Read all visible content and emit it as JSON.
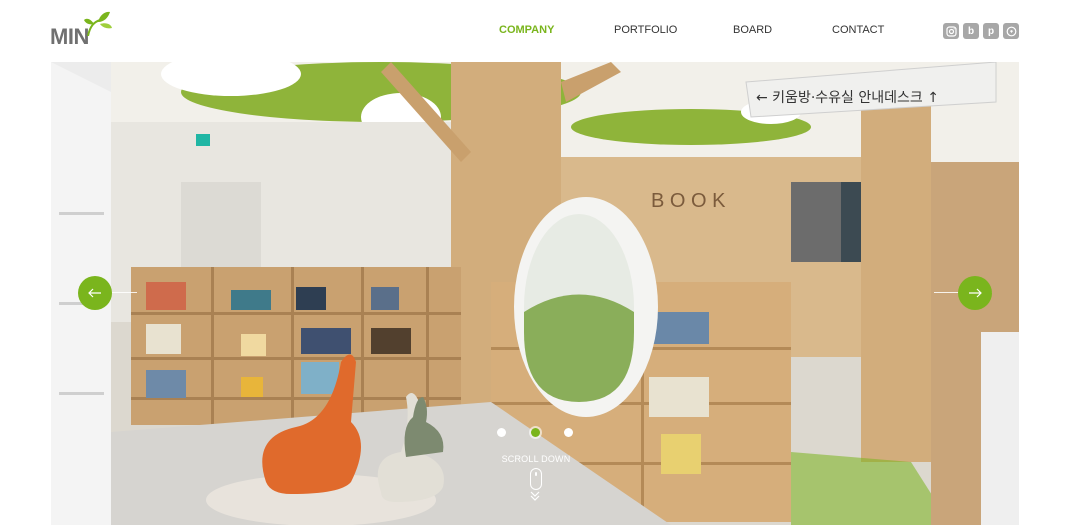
{
  "logo": {
    "text": "MIN",
    "icon": "leaf-sprout-icon"
  },
  "nav": {
    "items": [
      {
        "label": "COMPANY",
        "active": true
      },
      {
        "label": "PORTFOLIO",
        "active": false
      },
      {
        "label": "BOARD",
        "active": false
      },
      {
        "label": "CONTACT",
        "active": false
      }
    ]
  },
  "social": [
    {
      "icon": "instagram-icon",
      "glyph": "◎"
    },
    {
      "icon": "blog-icon",
      "glyph": "b"
    },
    {
      "icon": "pinterest-icon",
      "glyph": "p"
    },
    {
      "icon": "kakao-icon",
      "glyph": "●"
    }
  ],
  "hero": {
    "sign_text": "← 키움방·수유실   안내데스크 ↑",
    "book_letters": "BOOK",
    "slider": {
      "total": 3,
      "active": 2
    },
    "scroll_label": "SCROLL DOWN"
  },
  "colors": {
    "accent": "#7ab51d",
    "nav_text": "#333333",
    "social_bg": "#a7a7a7"
  }
}
